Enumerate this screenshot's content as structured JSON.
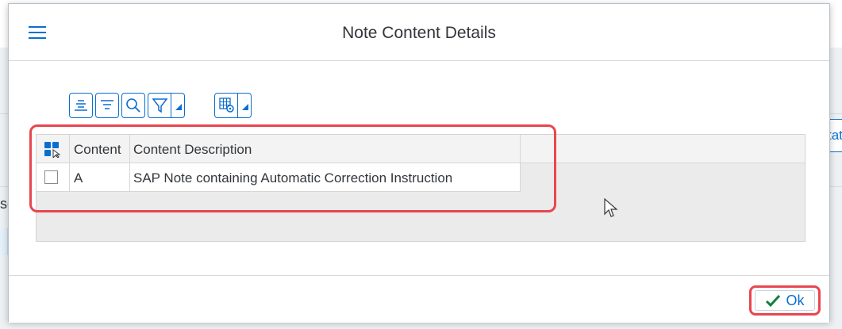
{
  "dialog": {
    "title": "Note Content Details"
  },
  "background": {
    "left_text": "se",
    "right_button_label": "tat"
  },
  "toolbar": {
    "icons": [
      "align-center-icon",
      "sort-icon",
      "search-icon",
      "filter-icon",
      "table-settings-icon"
    ]
  },
  "table": {
    "columns": [
      "Content",
      "Content Description"
    ],
    "rows": [
      {
        "content": "A",
        "description": "SAP Note containing Automatic Correction Instruction",
        "selected": false
      }
    ]
  },
  "footer": {
    "ok_label": "Ok"
  },
  "colors": {
    "accent": "#0a6ed1",
    "highlight": "#e8464f",
    "ok_check": "#107e3e"
  }
}
